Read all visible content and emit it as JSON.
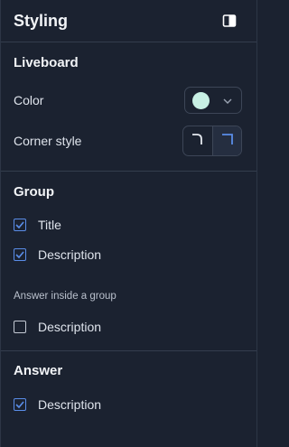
{
  "header": {
    "title": "Styling"
  },
  "liveboard": {
    "title": "Liveboard",
    "color_label": "Color",
    "color_value": "#c8f0e4",
    "corner_label": "Corner style",
    "corner_selected": "square"
  },
  "group": {
    "title": "Group",
    "options": [
      {
        "label": "Title",
        "checked": true
      },
      {
        "label": "Description",
        "checked": true
      }
    ],
    "answer_inside_label": "Answer inside a group",
    "answer_inside_options": [
      {
        "label": "Description",
        "checked": false
      }
    ]
  },
  "answer": {
    "title": "Answer",
    "options": [
      {
        "label": "Description",
        "checked": true
      }
    ]
  },
  "colors": {
    "background": "#1b2230",
    "accent": "#5a8de8"
  }
}
